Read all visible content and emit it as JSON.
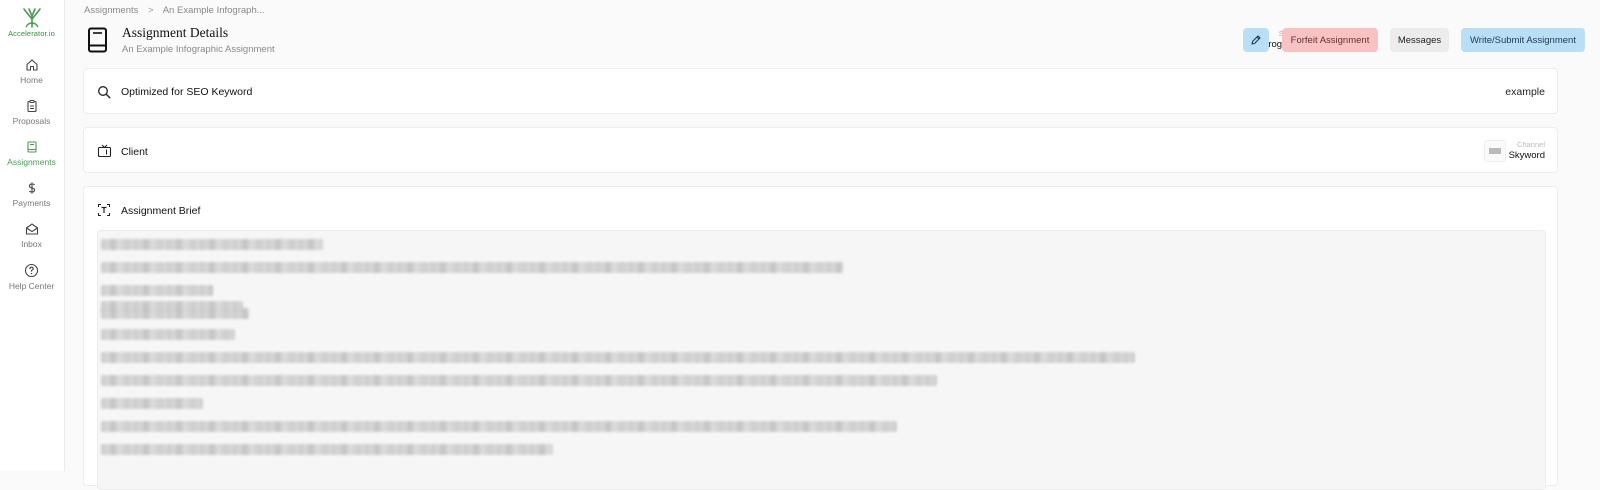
{
  "sidebar": {
    "logo_text": "Accelerator.io",
    "items": [
      {
        "label": "Home",
        "icon": "home-icon"
      },
      {
        "label": "Proposals",
        "icon": "clipboard-icon"
      },
      {
        "label": "Assignments",
        "icon": "book-icon",
        "active": true
      },
      {
        "label": "Payments",
        "icon": "dollar-icon"
      },
      {
        "label": "Inbox",
        "icon": "inbox-icon"
      },
      {
        "label": "Help Center",
        "icon": "help-icon"
      }
    ]
  },
  "breadcrumb": {
    "items": [
      "Assignments",
      "An Example Infograph..."
    ],
    "separator": ">"
  },
  "header": {
    "title": "Assignment Details",
    "subtitle": "An Example Infographic Assignment",
    "status_label": "Status",
    "status_value": "In Progress",
    "buttons": {
      "forfeit": "Forfeit Assignment",
      "messages": "Messages",
      "submit": "Write/Submit Assignment"
    }
  },
  "seo": {
    "label": "Optimized for SEO Keyword",
    "value": "example"
  },
  "client": {
    "label": "Client",
    "channel_label": "Channel",
    "channel_value": "Skyword"
  },
  "brief": {
    "label": "Assignment Brief",
    "content_state": "blurred"
  },
  "colors": {
    "brand_green": "#4a9a50",
    "primary_button": "#b9dff7",
    "danger_button": "#f8c2c2",
    "neutral_button": "#ececec"
  }
}
